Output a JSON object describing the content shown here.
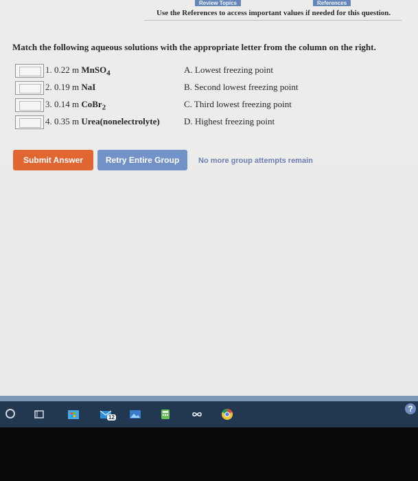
{
  "header": {
    "tab_review": "Review Topics",
    "tab_references": "References",
    "reference_note": "Use the References to access important values if needed for this question."
  },
  "question": {
    "prompt": "Match the following aqueous solutions with the appropriate letter from the column on the right.",
    "items": [
      {
        "num": "1.",
        "conc": "0.22 m",
        "formula": "MnSO4"
      },
      {
        "num": "2.",
        "conc": "0.19 m",
        "formula": "NaI"
      },
      {
        "num": "3.",
        "conc": "0.14 m",
        "formula": "CoBr2"
      },
      {
        "num": "4.",
        "conc": "0.35 m",
        "formula": "Urea(nonelectrolyte)"
      }
    ],
    "options": [
      "A. Lowest freezing point",
      "B. Second lowest freezing point",
      "C. Third lowest freezing point",
      "D. Highest freezing point"
    ]
  },
  "actions": {
    "submit_label": "Submit Answer",
    "retry_label": "Retry Entire Group",
    "status": "No more group attempts remain"
  },
  "taskbar": {
    "badge": "12",
    "icons": [
      "start-circle-icon",
      "task-view-icon",
      "store-icon",
      "mail-icon",
      "photos-icon",
      "calculator-icon",
      "loop-icon",
      "chrome-icon",
      "help-icon"
    ]
  },
  "colors": {
    "submit": "#e1622c",
    "retry": "#6e8fc6",
    "taskbar": "#223851"
  }
}
